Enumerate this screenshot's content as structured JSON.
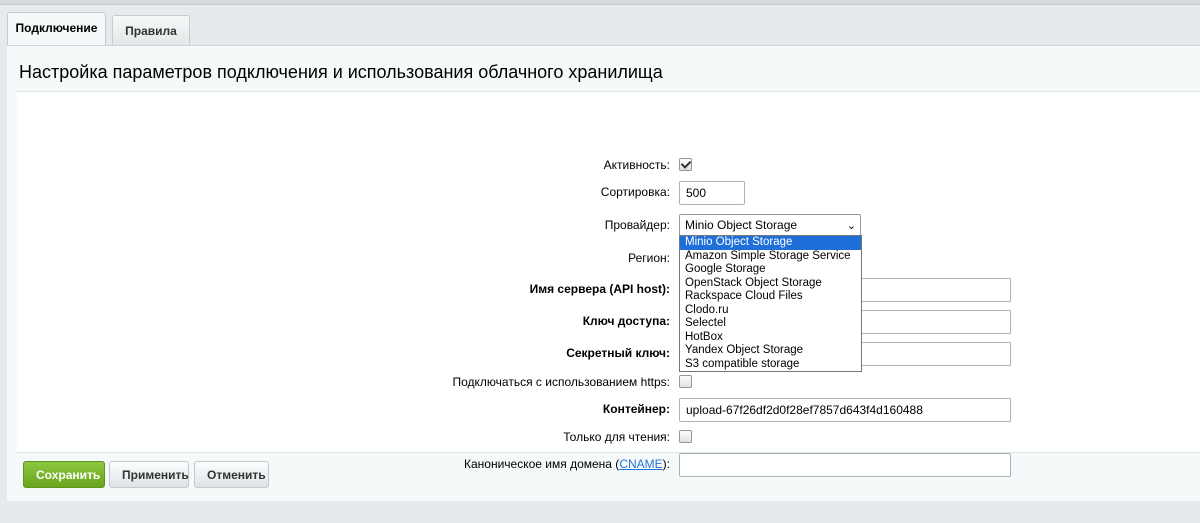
{
  "tabs": [
    {
      "label": "Подключение",
      "active": true
    },
    {
      "label": "Правила",
      "active": false
    }
  ],
  "title": "Настройка параметров подключения и использования облачного хранилища",
  "form": {
    "active_label": "Активность:",
    "active_checked": true,
    "sort_label": "Сортировка:",
    "sort_value": "500",
    "provider_label": "Провайдер:",
    "provider_value": "Minio Object Storage",
    "provider_options": [
      "Minio Object Storage",
      "Amazon Simple Storage Service",
      "Google Storage",
      "OpenStack Object Storage",
      "Rackspace Cloud Files",
      "Clodo.ru",
      "Selectel",
      "HotBox",
      "Yandex Object Storage",
      "S3 compatible storage"
    ],
    "region_label": "Регион:",
    "server_label": "Имя сервера (API host):",
    "server_value": "",
    "access_key_label": "Ключ доступа:",
    "access_key_value": "",
    "secret_key_label": "Секретный ключ:",
    "secret_key_value": "",
    "https_label": "Подключаться с использованием https:",
    "https_checked": false,
    "container_label": "Контейнер:",
    "container_value": "upload-67f26df2d0f28ef7857d643f4d160488",
    "readonly_label": "Только для чтения:",
    "readonly_checked": false,
    "cname_label_prefix": "Каноническое имя домена (",
    "cname_link": "CNAME",
    "cname_label_suffix": "):",
    "cname_value": ""
  },
  "buttons": {
    "save": "Сохранить",
    "apply": "Применить",
    "cancel": "Отменить"
  },
  "colors": {
    "save_button": "#7ab52c",
    "selected_option": "#1e6fd9",
    "link": "#2675d7"
  }
}
